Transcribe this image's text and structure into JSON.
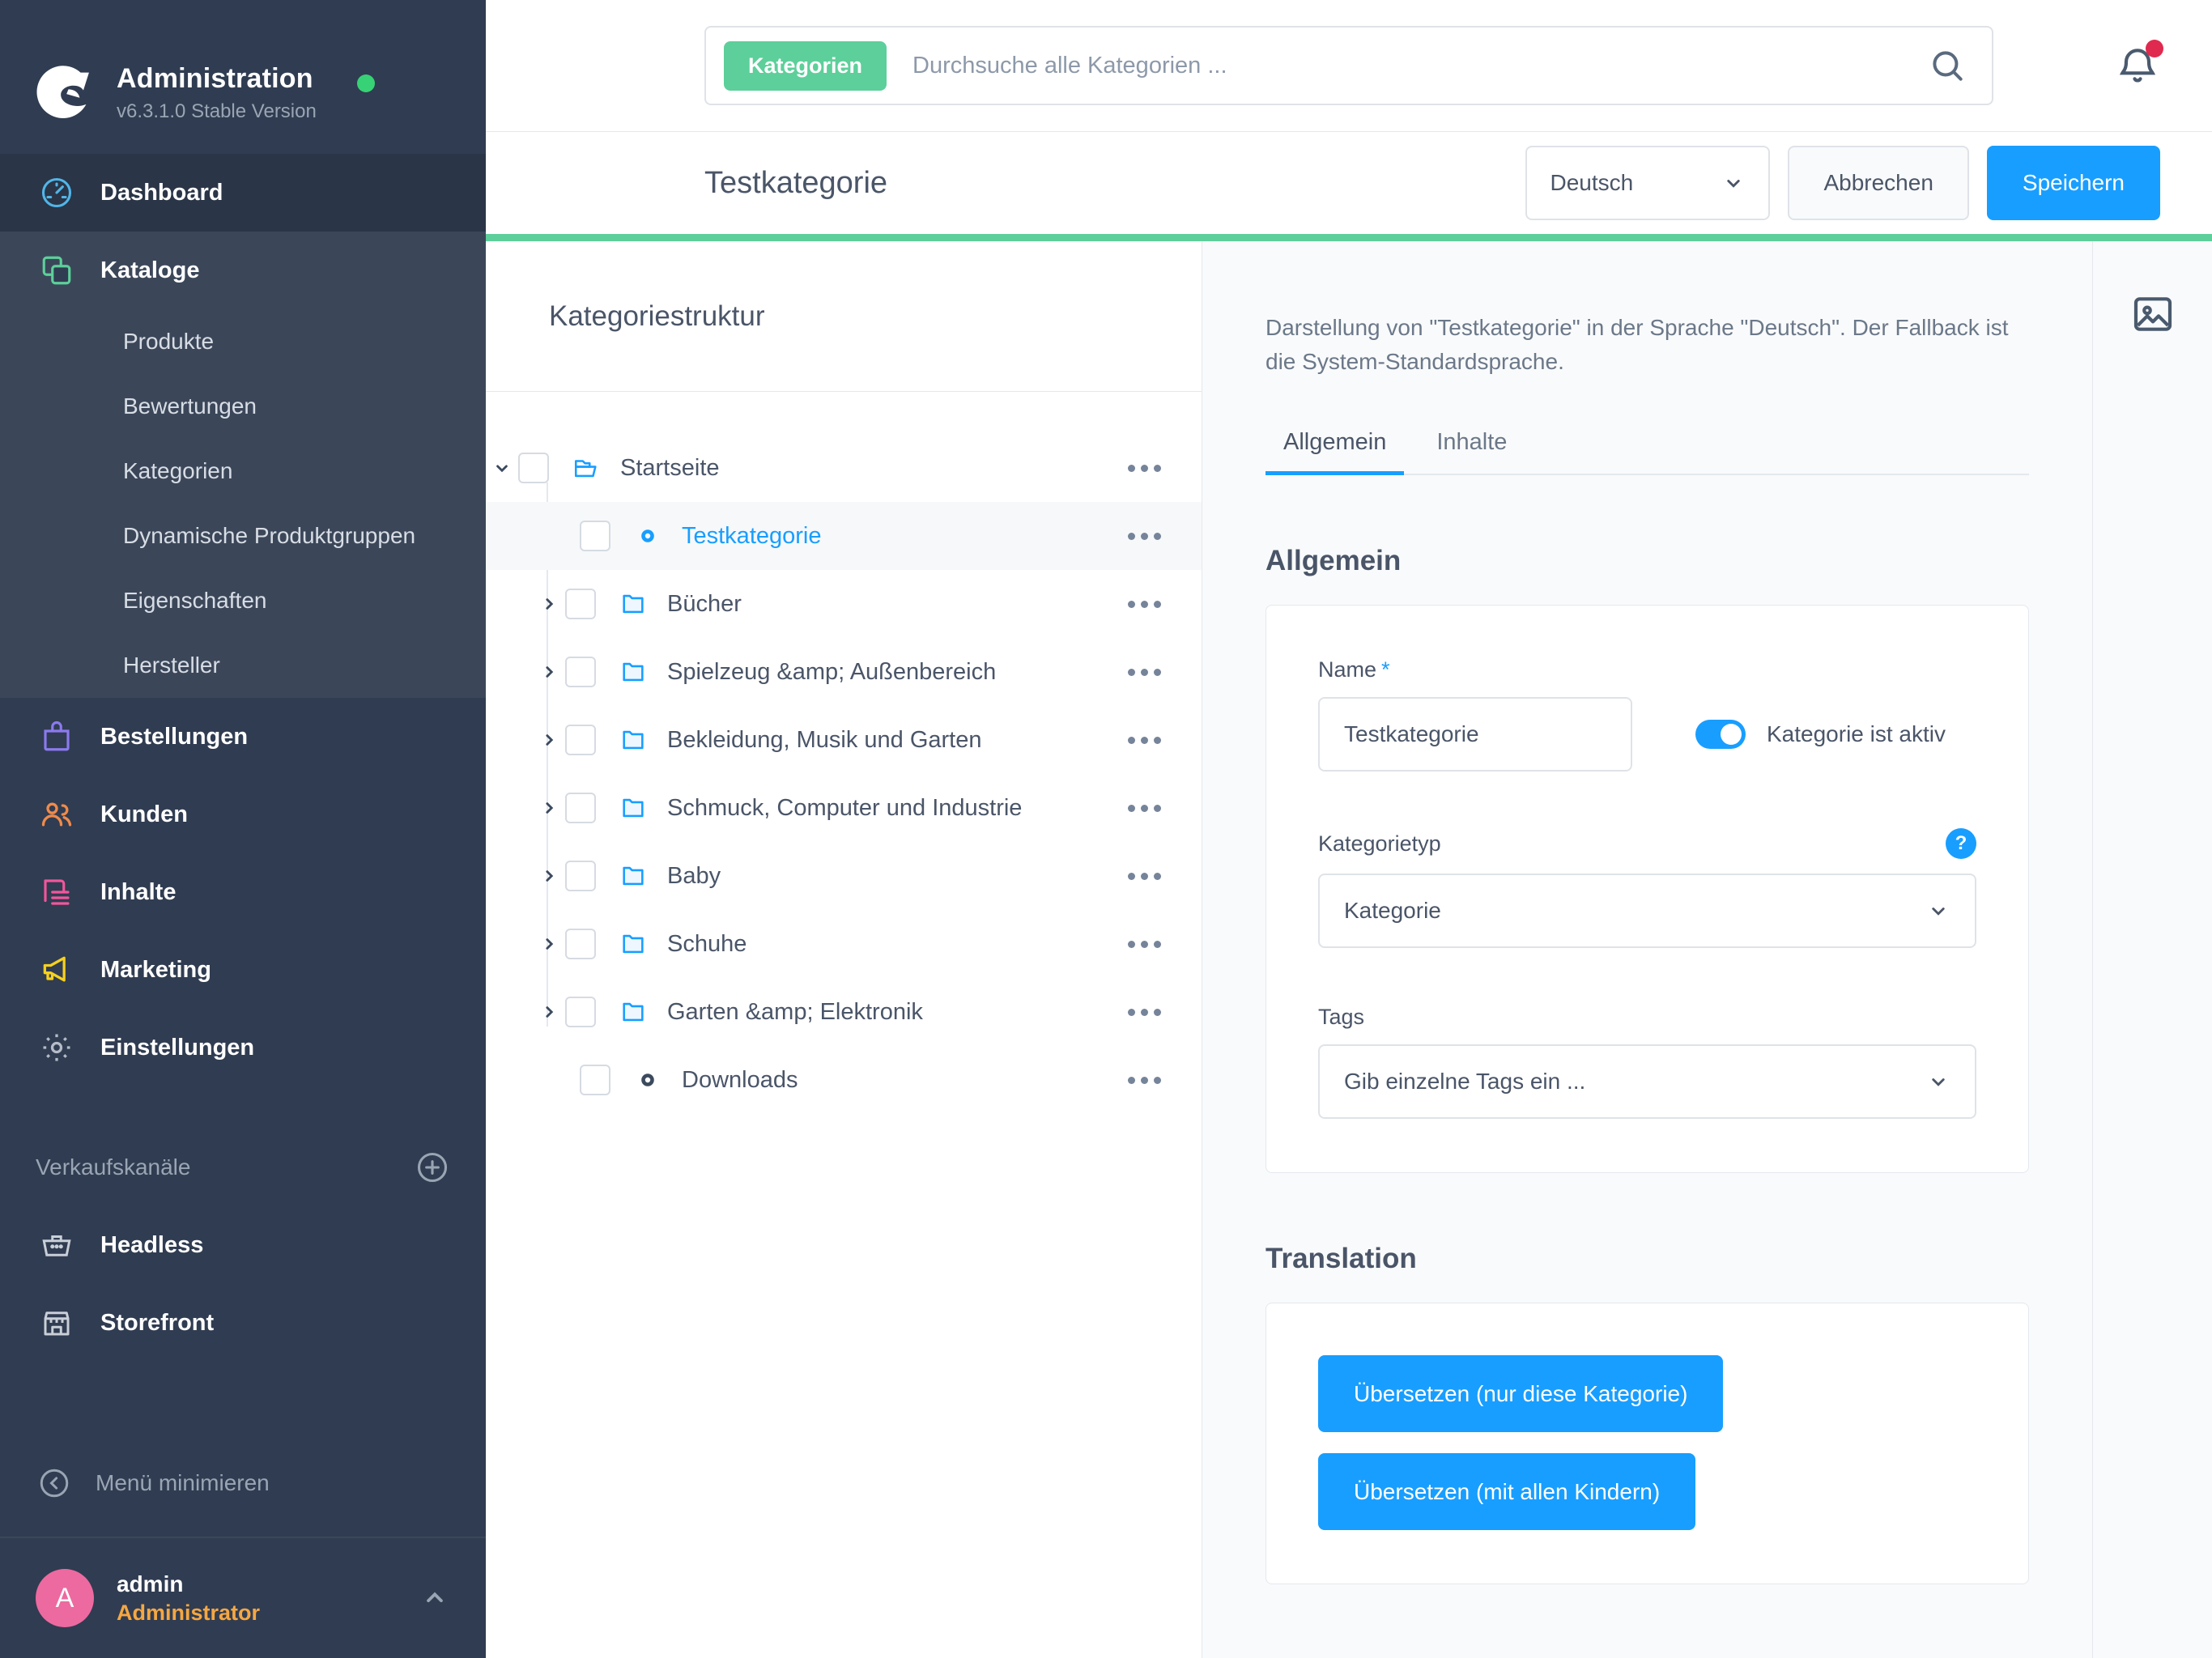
{
  "sidebar": {
    "title": "Administration",
    "version": "v6.3.1.0 Stable Version",
    "nav": [
      {
        "label": "Dashboard",
        "icon": "dashboard-icon"
      },
      {
        "label": "Kataloge",
        "icon": "catalog-icon"
      },
      {
        "label": "Bestellungen",
        "icon": "orders-bag-icon"
      },
      {
        "label": "Kunden",
        "icon": "customers-icon"
      },
      {
        "label": "Inhalte",
        "icon": "content-icon"
      },
      {
        "label": "Marketing",
        "icon": "megaphone-icon"
      },
      {
        "label": "Einstellungen",
        "icon": "gear-icon"
      }
    ],
    "kataloge_sub": [
      {
        "label": "Produkte"
      },
      {
        "label": "Bewertungen"
      },
      {
        "label": "Kategorien"
      },
      {
        "label": "Dynamische Produktgruppen"
      },
      {
        "label": "Eigenschaften"
      },
      {
        "label": "Hersteller"
      }
    ],
    "sales_channels_title": "Verkaufskanäle",
    "sales_channels": [
      {
        "label": "Headless",
        "icon": "basket-icon"
      },
      {
        "label": "Storefront",
        "icon": "shop-icon"
      }
    ],
    "minimize_label": "Menü minimieren",
    "user": {
      "initial": "A",
      "name": "admin",
      "role": "Administrator"
    }
  },
  "topbar": {
    "search_badge": "Kategorien",
    "search_placeholder": "Durchsuche alle Kategorien ...",
    "search_value": ""
  },
  "page_header": {
    "title": "Testkategorie",
    "language": "Deutsch",
    "cancel_label": "Abbrechen",
    "save_label": "Speichern"
  },
  "tree": {
    "heading": "Kategoriestruktur",
    "items": [
      {
        "label": "Startseite",
        "icon": "folder-open-icon",
        "chevron": "down",
        "indent": 0,
        "selected": false
      },
      {
        "label": "Testkategorie",
        "icon": "dot-icon",
        "chevron": "none",
        "indent": 2,
        "selected": true
      },
      {
        "label": "Bücher",
        "icon": "folder-icon",
        "chevron": "right",
        "indent": 1,
        "selected": false
      },
      {
        "label": "Spielzeug &amp; Außenbereich",
        "icon": "folder-icon",
        "chevron": "right",
        "indent": 1,
        "selected": false
      },
      {
        "label": "Bekleidung, Musik und Garten",
        "icon": "folder-icon",
        "chevron": "right",
        "indent": 1,
        "selected": false
      },
      {
        "label": "Schmuck, Computer und Industrie",
        "icon": "folder-icon",
        "chevron": "right",
        "indent": 1,
        "selected": false
      },
      {
        "label": "Baby",
        "icon": "folder-icon",
        "chevron": "right",
        "indent": 1,
        "selected": false
      },
      {
        "label": "Schuhe",
        "icon": "folder-icon",
        "chevron": "right",
        "indent": 1,
        "selected": false
      },
      {
        "label": "Garten &amp; Elektronik",
        "icon": "folder-icon",
        "chevron": "right",
        "indent": 1,
        "selected": false
      },
      {
        "label": "Downloads",
        "icon": "dot-icon",
        "chevron": "none",
        "indent": 2,
        "selected": false
      }
    ]
  },
  "detail": {
    "description": "Darstellung von \"Testkategorie\" in der Sprache \"Deutsch\". Der Fallback ist die System-Standardsprache.",
    "tabs": [
      {
        "label": "Allgemein",
        "active": true
      },
      {
        "label": "Inhalte",
        "active": false
      }
    ],
    "general_section_title": "Allgemein",
    "name_label": "Name",
    "name_required": "*",
    "name_value": "Testkategorie",
    "active_toggle_label": "Kategorie ist aktiv",
    "category_type_label": "Kategorietyp",
    "category_type_value": "Kategorie",
    "category_type_help": "?",
    "tags_label": "Tags",
    "tags_placeholder": "Gib einzelne Tags ein ...",
    "translation_section_title": "Translation",
    "translate_single_label": "Übersetzen (nur diese Kategorie)",
    "translate_children_label": "Übersetzen (mit allen Kindern)"
  },
  "colors": {
    "sidebar_bg": "#303c51",
    "accent_green": "#5dcf9a",
    "accent_blue": "#189eff",
    "status_dot": "#37d275",
    "avatar": "#ec6aa0",
    "role_text": "#f5a742",
    "notification_dot": "#e0294e"
  }
}
